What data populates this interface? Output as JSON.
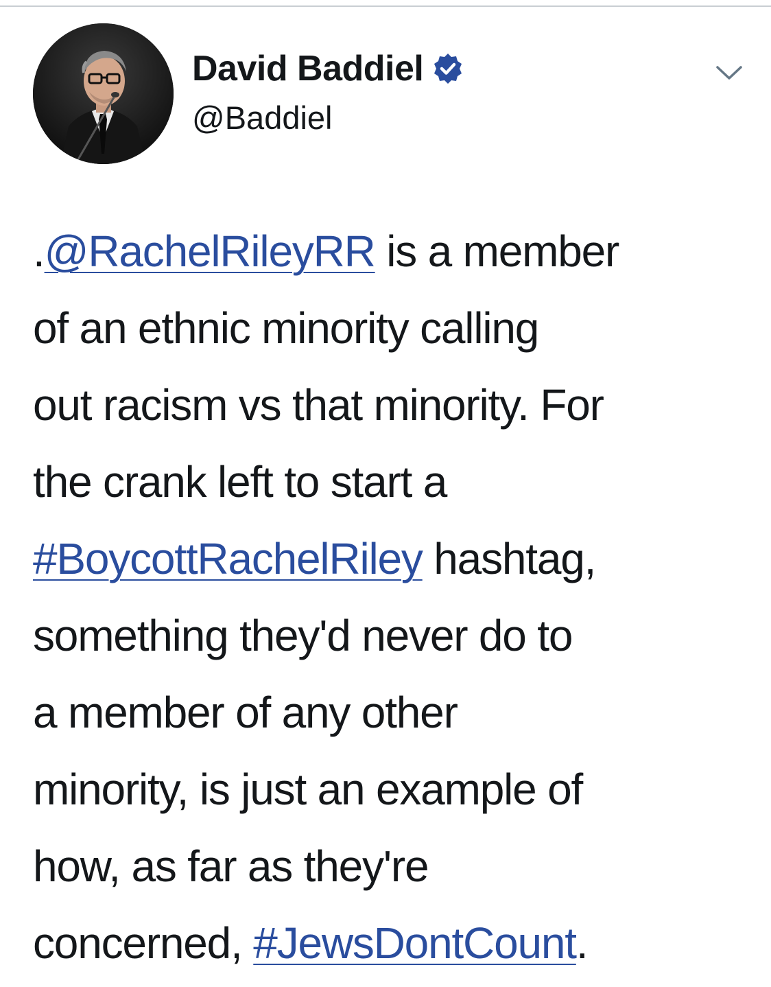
{
  "author": {
    "name": "David Baddiel",
    "handle": "@Baddiel",
    "verified_icon": "verified-check-icon",
    "avatar_icon": "profile-photo"
  },
  "menu": {
    "icon": "chevron-down-icon"
  },
  "tweet": {
    "lines": [
      [
        {
          "t": "."
        },
        {
          "link": "@RachelRileyRR"
        },
        {
          "t": " is a member"
        }
      ],
      [
        {
          "t": "of an ethnic minority calling"
        }
      ],
      [
        {
          "t": "out racism vs that minority. For"
        }
      ],
      [
        {
          "t": "the crank left to start a"
        }
      ],
      [
        {
          "link": "#BoycottRachelRiley"
        },
        {
          "t": " hashtag,"
        }
      ],
      [
        {
          "t": "something they'd never do to"
        }
      ],
      [
        {
          "t": "a member of any other"
        }
      ],
      [
        {
          "t": "minority, is just an example of"
        }
      ],
      [
        {
          "t": "how, as far as they're"
        }
      ],
      [
        {
          "t": "concerned, "
        },
        {
          "link": "#JewsDontCount"
        },
        {
          "t": "."
        }
      ]
    ]
  },
  "colors": {
    "link": "#2a4d9e",
    "text": "#14171a",
    "verified": "#2a4d9e",
    "divider": "#c9ced3"
  }
}
